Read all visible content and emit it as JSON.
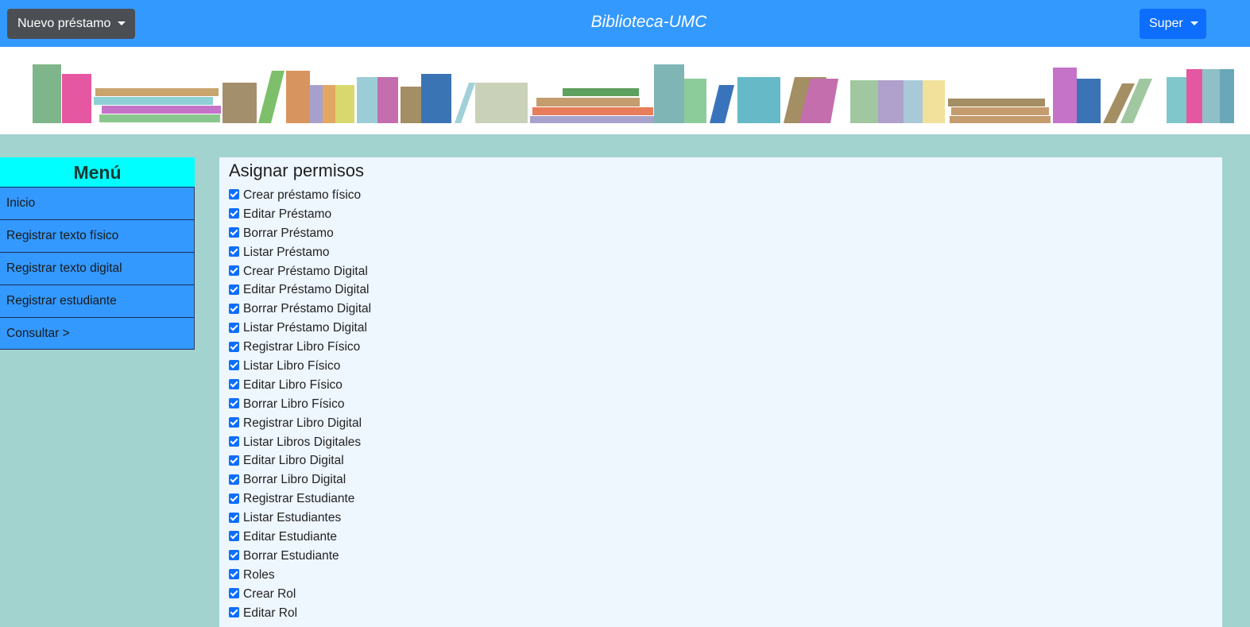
{
  "header": {
    "new_loan_label": "Nuevo préstamo",
    "brand": "Biblioteca-UMC",
    "user_label": "Super"
  },
  "menu": {
    "title": "Menú",
    "items": [
      {
        "label": "Inicio"
      },
      {
        "label": "Registrar texto físico"
      },
      {
        "label": "Registrar texto digital"
      },
      {
        "label": "Registrar estudiante"
      },
      {
        "label": "Consultar >"
      }
    ]
  },
  "permissions": {
    "title": "Asignar permisos",
    "items": [
      {
        "label": "Crear préstamo físico",
        "checked": true
      },
      {
        "label": "Editar Préstamo",
        "checked": true
      },
      {
        "label": "Borrar Préstamo",
        "checked": true
      },
      {
        "label": "Listar Préstamo",
        "checked": true
      },
      {
        "label": "Crear Préstamo Digital",
        "checked": true
      },
      {
        "label": "Editar Préstamo Digital",
        "checked": true
      },
      {
        "label": "Borrar Préstamo Digital",
        "checked": true
      },
      {
        "label": "Listar Préstamo Digital",
        "checked": true
      },
      {
        "label": "Registrar Libro Físico",
        "checked": true
      },
      {
        "label": "Listar Libro Físico",
        "checked": true
      },
      {
        "label": "Editar Libro Físico",
        "checked": true
      },
      {
        "label": "Borrar Libro Físico",
        "checked": true
      },
      {
        "label": "Registrar Libro Digital",
        "checked": true
      },
      {
        "label": "Listar Libros Digitales",
        "checked": true
      },
      {
        "label": "Editar Libro Digital",
        "checked": true
      },
      {
        "label": "Borrar Libro Digital",
        "checked": true
      },
      {
        "label": "Registrar Estudiante",
        "checked": true
      },
      {
        "label": "Listar Estudiantes",
        "checked": true
      },
      {
        "label": "Editar Estudiante",
        "checked": true
      },
      {
        "label": "Borrar Estudiante",
        "checked": true
      },
      {
        "label": "Roles",
        "checked": true
      },
      {
        "label": "Crear Rol",
        "checked": true
      },
      {
        "label": "Editar Rol",
        "checked": true
      }
    ]
  },
  "colors": {
    "header_bg": "#3399fe",
    "page_bg": "#a2d3cf",
    "menu_title_bg": "#00ffff",
    "menu_item_bg": "#3399fe",
    "panel_bg": "#eef6fe",
    "checkbox": "#0d6efd"
  }
}
